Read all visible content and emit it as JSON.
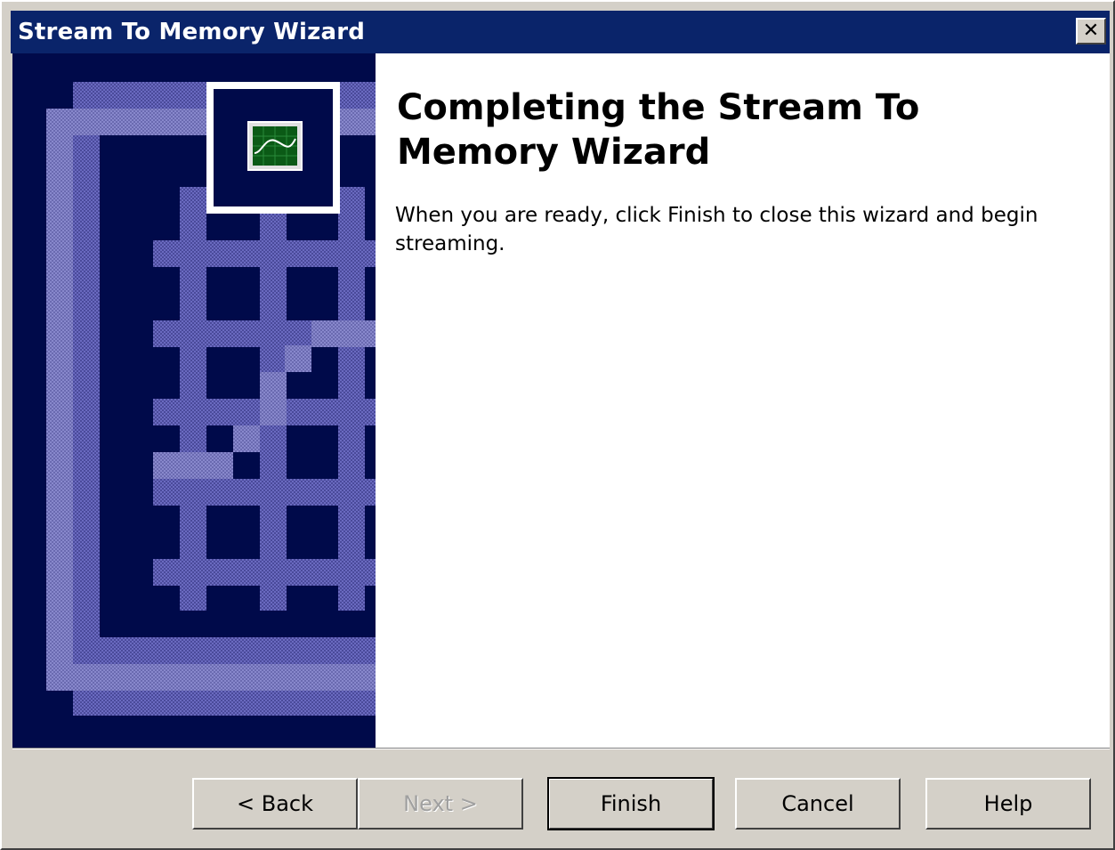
{
  "window": {
    "title": "Stream To Memory Wizard",
    "close_label": "✕"
  },
  "icons": {
    "close": "close-icon",
    "wizard_graphic": "wizard-watermark-icon",
    "oscilloscope": "oscilloscope-icon"
  },
  "main": {
    "heading": "Completing the Stream To Memory Wizard",
    "body": "When you are ready, click Finish to close this wizard and begin streaming."
  },
  "buttons": {
    "back": "< Back",
    "next": "Next >",
    "finish": "Finish",
    "cancel": "Cancel",
    "help": "Help"
  },
  "colors": {
    "titlebar": "#0a246a",
    "panel_bg": "#000a4a",
    "panel_accent": "#5a5ab0",
    "dialog_face": "#d4d0c8"
  }
}
